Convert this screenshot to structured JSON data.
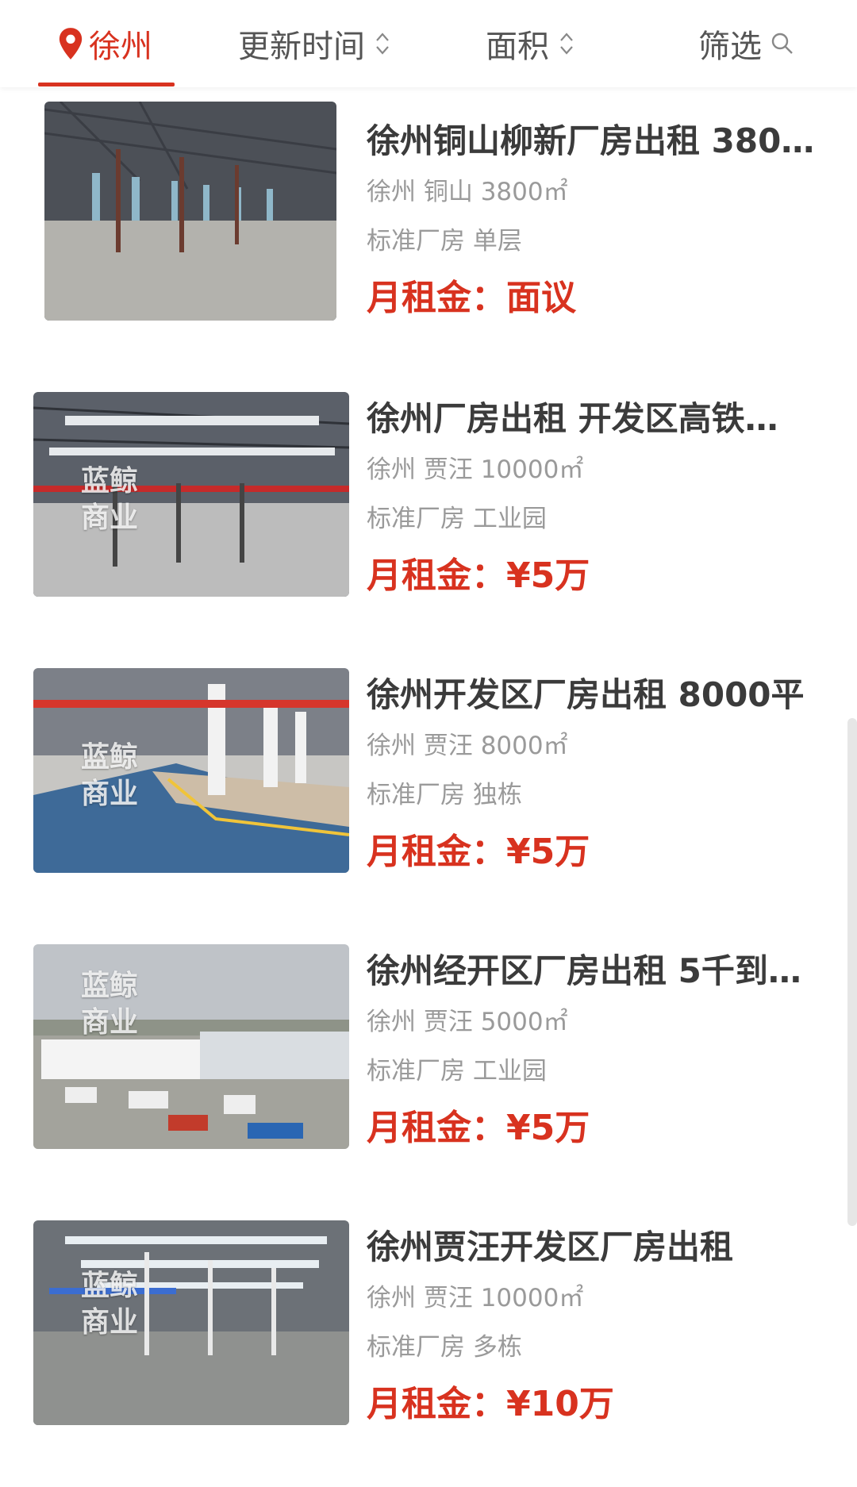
{
  "filter_bar": {
    "city": "徐州",
    "sort_time": "更新时间",
    "sort_area": "面积",
    "filter": "筛选"
  },
  "listings": [
    {
      "title": "徐州铜山柳新厂房出租 3800…",
      "location": "徐州 铜山 3800㎡",
      "type": "标准厂房 单层",
      "price_label": "月租金：",
      "price": "面议"
    },
    {
      "title": "徐州厂房出租 开发区高铁…",
      "location": "徐州 贾汪 10000㎡",
      "type": "标准厂房 工业园",
      "price_label": "月租金：",
      "price": "¥5万",
      "watermark": [
        "蓝鲸",
        "商业"
      ]
    },
    {
      "title": "徐州开发区厂房出租 8000平",
      "location": "徐州 贾汪 8000㎡",
      "type": "标准厂房 独栋",
      "price_label": "月租金：",
      "price": "¥5万",
      "watermark": [
        "蓝鲸",
        "商业"
      ]
    },
    {
      "title": "徐州经开区厂房出租 5千到…",
      "location": "徐州 贾汪 5000㎡",
      "type": "标准厂房 工业园",
      "price_label": "月租金：",
      "price": "¥5万",
      "watermark": [
        "蓝鲸",
        "商业"
      ]
    },
    {
      "title": "徐州贾汪开发区厂房出租",
      "location": "徐州 贾汪 10000㎡",
      "type": "标准厂房 多栋",
      "price_label": "月租金：",
      "price": "¥10万",
      "watermark": [
        "蓝鲸",
        "商业"
      ]
    }
  ],
  "colors": {
    "accent": "#d8321f",
    "title": "#3b3b3b",
    "meta": "#9a9a9a"
  }
}
